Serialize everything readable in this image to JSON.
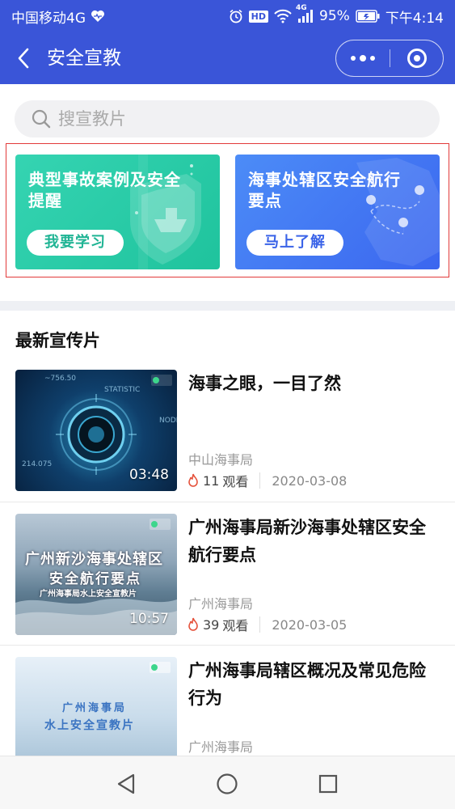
{
  "status_bar": {
    "carrier": "中国移动4G",
    "battery": "95%",
    "time": "下午4:14",
    "hd": "HD",
    "signal_tag": "4G"
  },
  "nav": {
    "title": "安全宣教"
  },
  "search": {
    "placeholder": "搜宣教片"
  },
  "banners": [
    {
      "title": "典型事故案例及安全提醒",
      "button": "我要学习",
      "color": "#26c9a4"
    },
    {
      "title": "海事处辖区安全航行要点",
      "button": "马上了解",
      "color": "#4479f2"
    }
  ],
  "section": {
    "title": "最新宣传片"
  },
  "videos": [
    {
      "title": "海事之眼，一目了然",
      "source": "中山海事局",
      "duration": "03:48",
      "views": "11",
      "views_label": "观看",
      "date": "2020-03-08"
    },
    {
      "title": "广州海事局新沙海事处辖区安全航行要点",
      "source": "广州海事局",
      "duration": "10:57",
      "views": "39",
      "views_label": "观看",
      "date": "2020-03-05"
    },
    {
      "title": "广州海事局辖区概况及常见危险行为",
      "source": "广州海事局",
      "duration": "",
      "views": "",
      "views_label": "",
      "date": ""
    }
  ],
  "thumb_text": {
    "v1_stat": "STATISTIC",
    "v1_node": "NODE",
    "v1_num1": "~756.50",
    "v1_num2": "214.075",
    "v2_line1": "广州新沙海事处辖区",
    "v2_line2": "安全航行要点",
    "v2_line3": "广州海事局水上安全宣教片",
    "v3_line1": "广州海事局",
    "v3_line2": "水上安全宣教片"
  },
  "colors": {
    "brand": "#3a55d8",
    "highlight": "#e23a3a",
    "fire": "#e5533d"
  }
}
